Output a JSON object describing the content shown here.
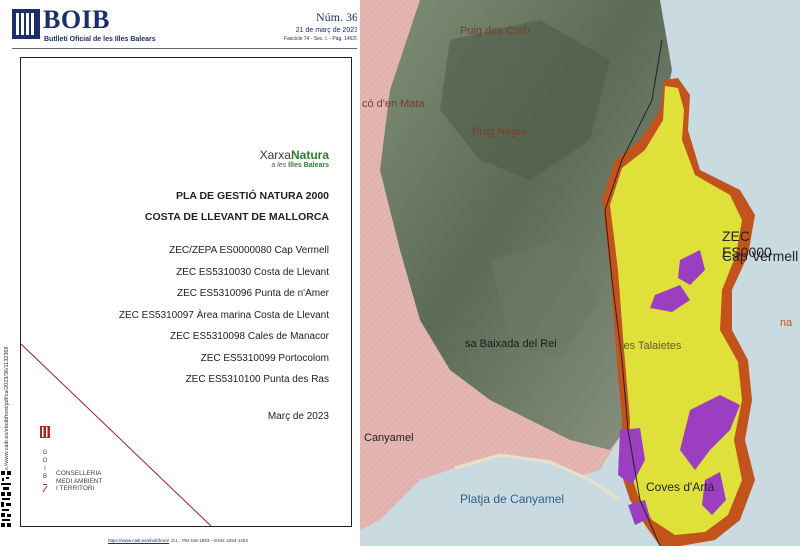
{
  "header": {
    "brand": "BOIB",
    "subtitle": "Butlletí Oficial de les Illes Balears",
    "number": "Núm. 36",
    "date": "21 de març de 2023",
    "fascicle": "Fascicle 74 - Sec. I. - Pàg. 14620"
  },
  "xarxa": {
    "title_a": "Xarxa",
    "title_b": "Natura",
    "sub_a": "a les ",
    "sub_b": "Illes Balears"
  },
  "plan": {
    "line1": "PLA DE GESTIÓ NATURA 2000",
    "line2": "COSTA DE LLEVANT DE MALLORCA"
  },
  "zones": [
    "ZEC/ZEPA ES0000080 Cap Vermell",
    "ZEC ES5310030 Costa de Llevant",
    "ZEC ES5310096 Punta de n'Amer",
    "ZEC ES5310097 Àrea marina Costa de Llevant",
    "ZEC ES5310098 Cales de Manacor",
    "ZEC ES5310099 Portocolom",
    "ZEC ES5310100 Punta des Ras"
  ],
  "doc_date": "Març de 2023",
  "conselleria": {
    "vertical": "GOIB",
    "line1": "CONSELLERIA",
    "line2": "MEDI AMBIENT",
    "line3": "I TERRITORI"
  },
  "side_url": "https://www.caib.es/eboibfront/pdf/ca/2023/36/1132368",
  "footer": {
    "url": "https://www.caib.es/eboibfront/",
    "rest": "D.L.: PM 448-1983 - ISSN: 2254-1253"
  },
  "map_labels": {
    "puig_corb": "Puig des Corb",
    "mata": "có d'en Mata",
    "puig_negre": "Puig Negre",
    "zec_code": "ZEC ES0000",
    "cap_vermell": "Cap Vermell",
    "na": "na",
    "baixada": "sa Baixada del Rei",
    "talaietes": "ses Talaietes",
    "canyamel": "Canyamel",
    "platja": "Platja de Canyamel",
    "coves": "Coves d'Artà"
  },
  "colors": {
    "brand_blue": "#1a2f6b",
    "zec_yellow": "#dfe03a",
    "habitat_purple": "#9b3fc0",
    "coast_red": "#c2531c",
    "urban_pink": "#e8b8b3",
    "sea": "#c9dbe0"
  }
}
